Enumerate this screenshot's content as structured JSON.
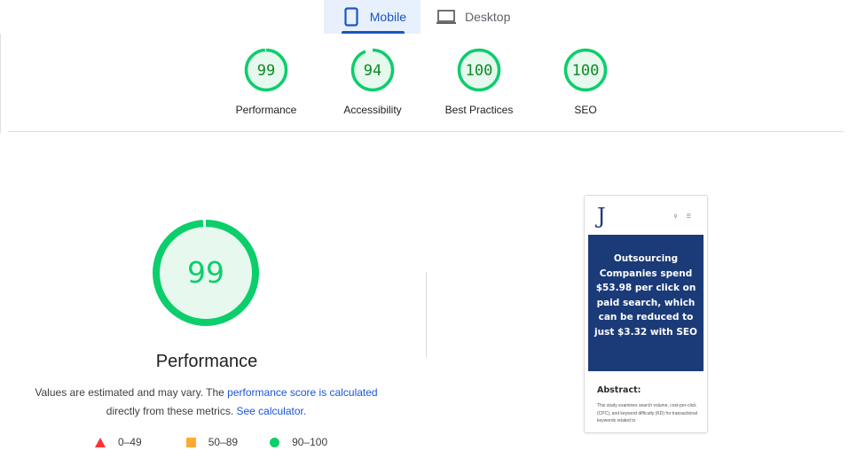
{
  "tabs": [
    {
      "label": "Mobile",
      "icon": "mobile-phone-icon",
      "active": true
    },
    {
      "label": "Desktop",
      "icon": "laptop-icon",
      "active": false
    }
  ],
  "category_scores": [
    {
      "label": "Performance",
      "score": 99,
      "score_text": "99"
    },
    {
      "label": "Accessibility",
      "score": 94,
      "score_text": "94"
    },
    {
      "label": "Best Practices",
      "score": 100,
      "score_text": "100"
    },
    {
      "label": "SEO",
      "score": 100,
      "score_text": "100"
    }
  ],
  "performance": {
    "score": 99,
    "score_text": "99",
    "title": "Performance",
    "desc_prefix": "Values are estimated and may vary. The ",
    "link1": "performance score is calculated",
    "desc_middle": " directly from these metrics. ",
    "link2": "See calculator."
  },
  "legend": [
    {
      "symbol": "triangle",
      "range": "0–49",
      "color": "#ff3333"
    },
    {
      "symbol": "square",
      "range": "50–89",
      "color": "#ffaa33"
    },
    {
      "symbol": "circle",
      "range": "90–100",
      "color": "#0cce6b"
    }
  ],
  "colors": {
    "pass": "#0cce6b",
    "pass_fill": "#e7f9ef",
    "pass_text": "#0c8a1f",
    "accent": "#1a56c0",
    "banner": "#1b3a78"
  },
  "screenshot": {
    "logo": "J",
    "banner_text": "Outsourcing Companies spend $53.98 per click on paid search, which can be reduced to just $3.32 with SEO",
    "abstract_heading": "Abstract:",
    "abstract_text": "This study examines search volume, cost-per-click (CPC), and keyword difficulty (KD) for transactional keywords related to"
  }
}
